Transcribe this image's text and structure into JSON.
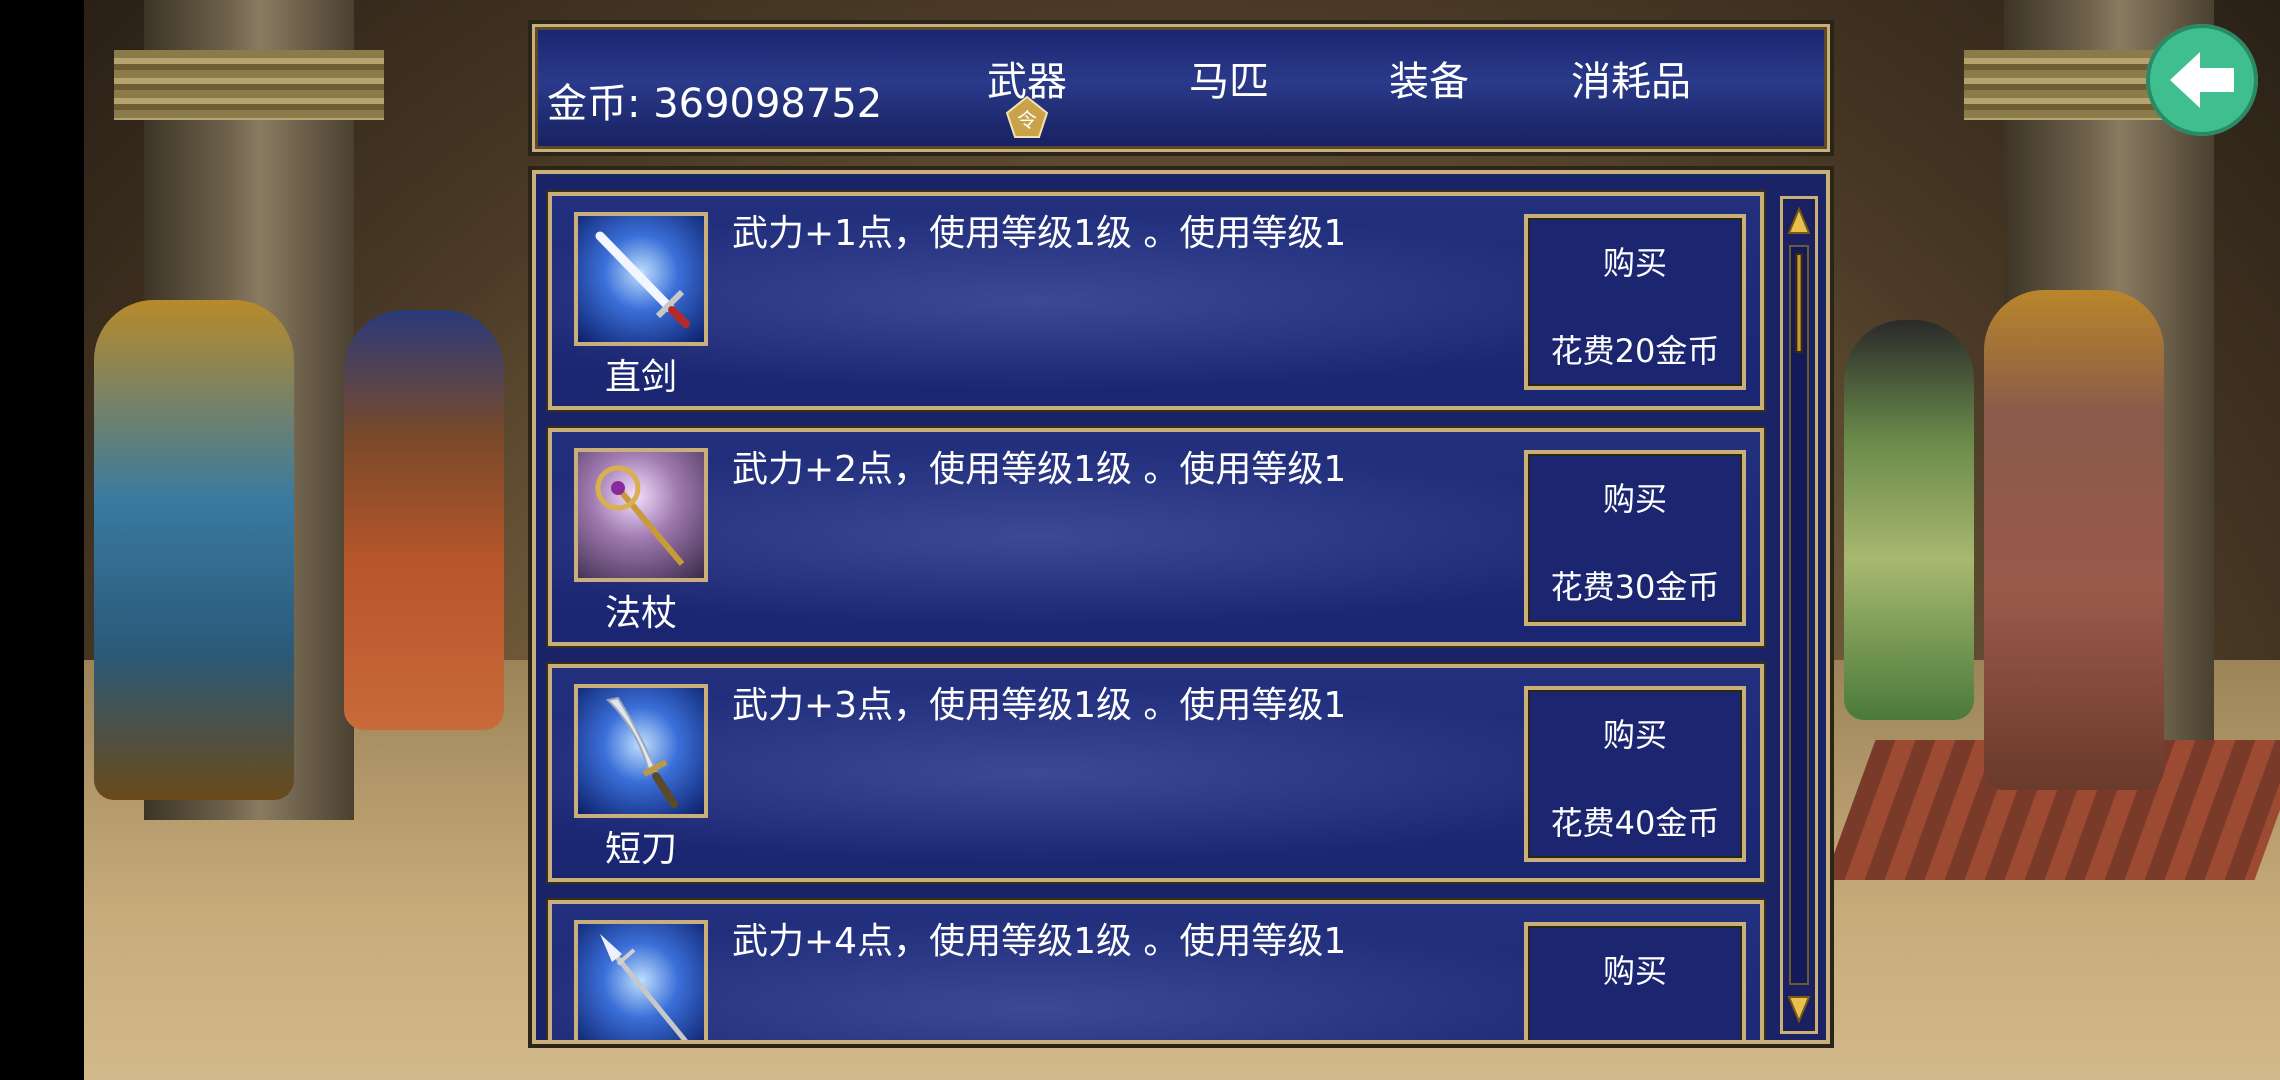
{
  "header": {
    "gold_label": "金币: 369098752",
    "tabs": [
      {
        "label": "武器",
        "selected": true,
        "marker": "令"
      },
      {
        "label": "马匹",
        "selected": false
      },
      {
        "label": "装备",
        "selected": false
      },
      {
        "label": "消耗品",
        "selected": false
      }
    ]
  },
  "items": [
    {
      "name": "直剑",
      "icon": "sword-icon",
      "desc": "武力+1点，使用等级1级 。使用等级1",
      "buy": "购买",
      "cost": "花费20金币"
    },
    {
      "name": "法杖",
      "icon": "staff-icon",
      "desc": "武力+2点，使用等级1级 。使用等级1",
      "buy": "购买",
      "cost": "花费30金币"
    },
    {
      "name": "短刀",
      "icon": "blade-icon",
      "desc": "武力+3点，使用等级1级 。使用等级1",
      "buy": "购买",
      "cost": "花费40金币"
    },
    {
      "name": "",
      "icon": "spear-icon",
      "desc": "武力+4点，使用等级1级 。使用等级1",
      "buy": "购买",
      "cost": ""
    }
  ],
  "colors": {
    "panel_blue": "#1b2570",
    "gold_border": "#c9b07a",
    "back_button": "#3fbf8f"
  },
  "controls": {
    "back_icon": "arrow-left-icon",
    "scroll_up_icon": "arrow-up-icon",
    "scroll_down_icon": "arrow-down-icon"
  }
}
